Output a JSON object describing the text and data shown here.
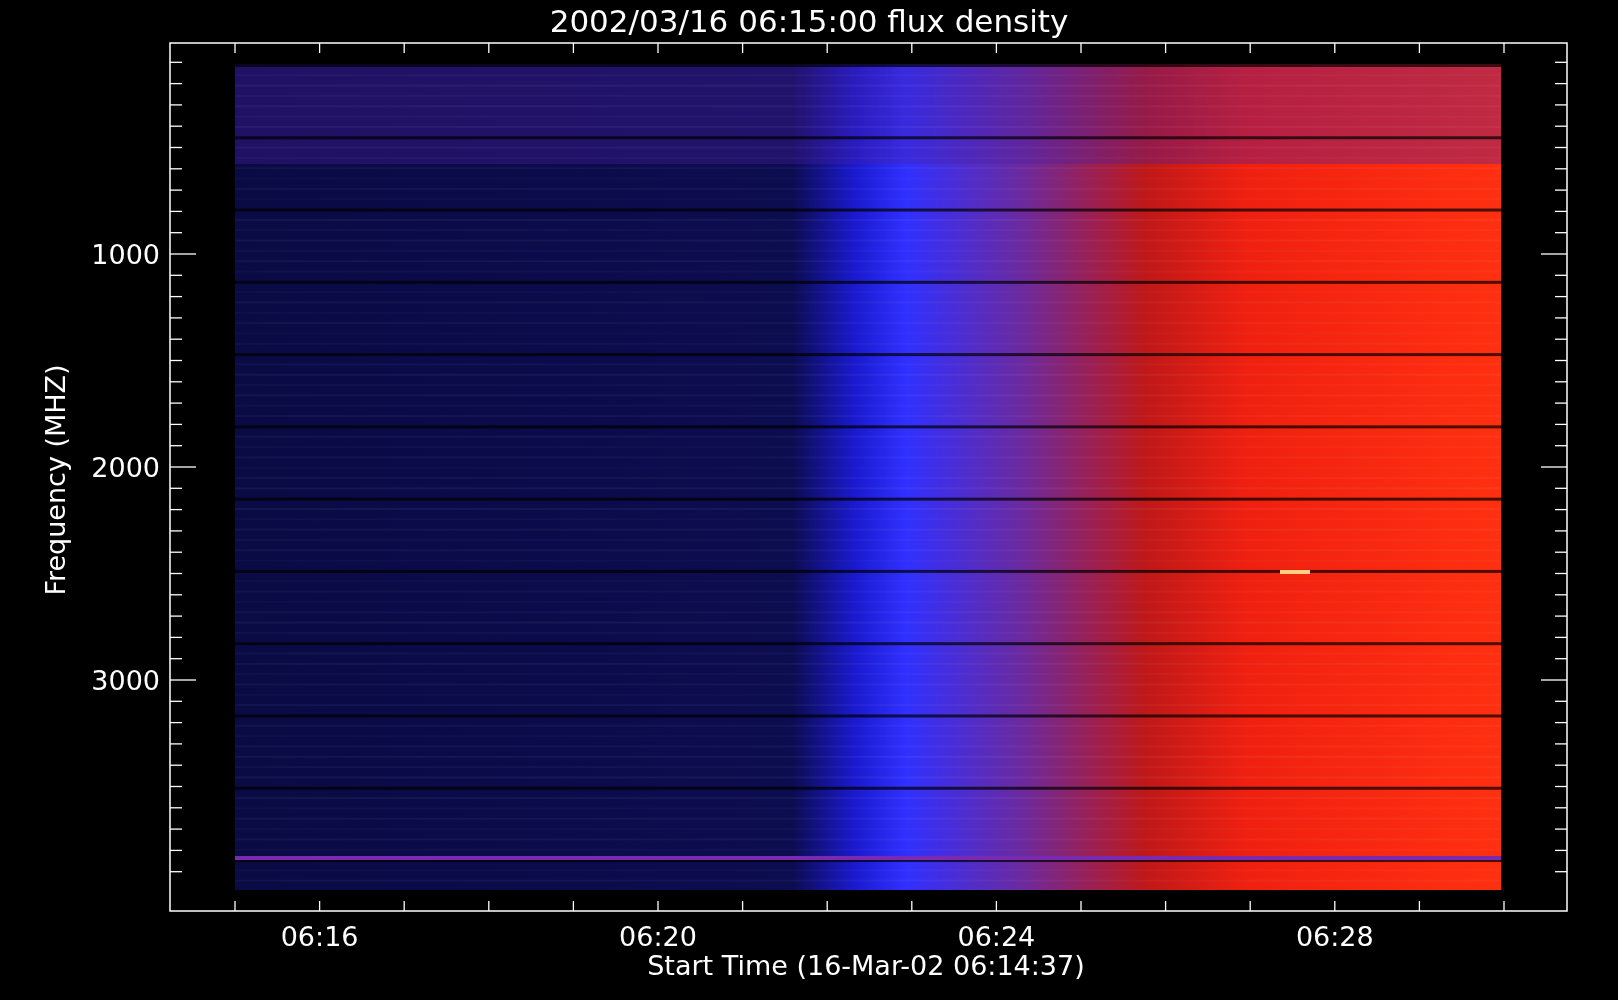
{
  "title": "2002/03/16 06:15:00 flux density",
  "y_axis": {
    "label": "Frequency (MHZ)",
    "ticks": [
      "1000",
      "2000",
      "3000"
    ]
  },
  "x_axis": {
    "label": "Start Time (16-Mar-02 06:14:37)",
    "ticks": [
      "06:16",
      "06:20",
      "06:24",
      "06:28"
    ]
  }
}
